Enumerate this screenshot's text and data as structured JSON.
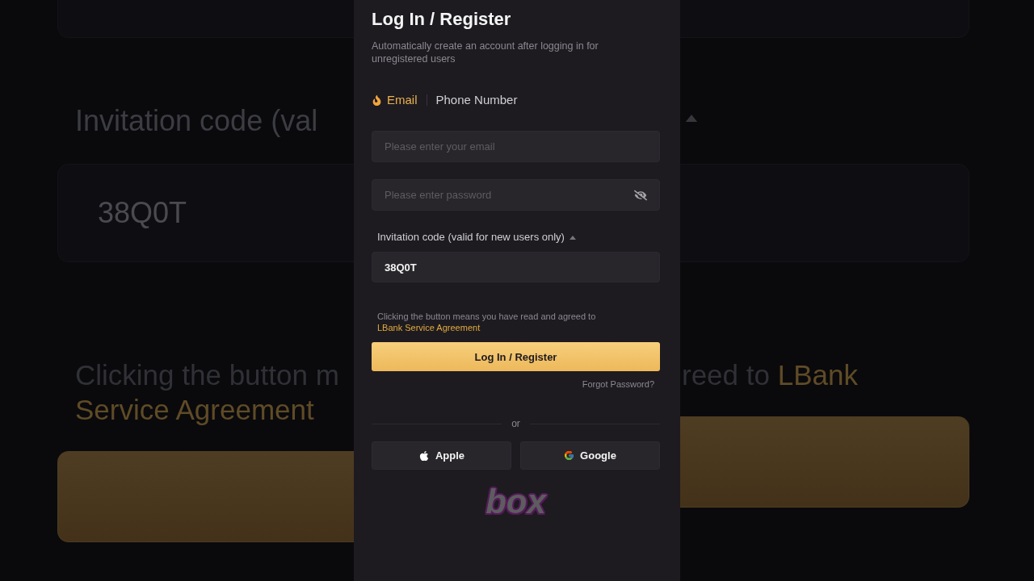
{
  "backdrop": {
    "left": {
      "invitation_label": "Invitation code (val",
      "invitation_value": "38Q0T",
      "agreement_text": "Clicking the button m",
      "agreement_link": "Service Agreement"
    },
    "right": {
      "agreement_text": "reed to",
      "agreement_link": "LBank"
    }
  },
  "title": "Log In / Register",
  "subtitle": "Automatically create an account after logging in for unregistered users",
  "tabs": [
    {
      "label": "Email",
      "selected": true,
      "hot": true
    },
    {
      "label": "Phone Number",
      "selected": false,
      "hot": false
    }
  ],
  "fields": [
    {
      "kind": "email",
      "placeholder": "Please enter your email"
    },
    {
      "kind": "password",
      "placeholder": "Please enter password",
      "masked": true
    }
  ],
  "invitation": {
    "label": "Invitation code (valid for new users only)",
    "expanded": true,
    "value": "38Q0T"
  },
  "agreement": {
    "text": "Clicking the button means you have read and agreed to",
    "link": "LBank Service Agreement"
  },
  "submit_button": "Log In / Register",
  "forgot_link": "Forgot Password?",
  "divider_label": "or",
  "social_buttons": [
    {
      "kind": "apple",
      "label": "Apple"
    },
    {
      "kind": "google",
      "label": "Google"
    }
  ],
  "caption": "box"
}
